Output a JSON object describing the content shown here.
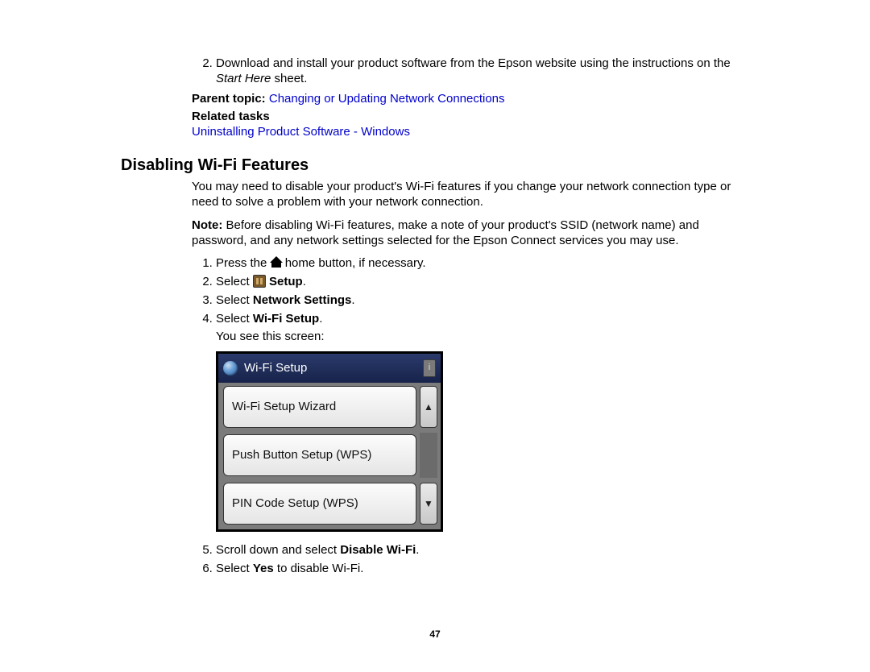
{
  "list2": {
    "item_text_before": "Download and install your product software from the Epson website using the instructions on the ",
    "item_italic": "Start Here",
    "item_text_after": " sheet."
  },
  "parent_topic_label": "Parent topic: ",
  "parent_topic_link": "Changing or Updating Network Connections",
  "related_tasks_label": "Related tasks",
  "related_task_link": "Uninstalling Product Software - Windows",
  "heading": "Disabling Wi-Fi Features",
  "intro": "You may need to disable your product's Wi-Fi features if you change your network connection type or need to solve a problem with your network connection.",
  "note_label": "Note: ",
  "note_text": "Before disabling Wi-Fi features, make a note of your product's SSID (network name) and password, and any network settings selected for the Epson Connect services you may use.",
  "steps": {
    "s1a": "Press the ",
    "s1b": " home button, if necessary.",
    "s2a": "Select ",
    "s2b": " Setup",
    "s2c": ".",
    "s3a": "Select ",
    "s3b": "Network Settings",
    "s3c": ".",
    "s4a": "Select ",
    "s4b": "Wi-Fi Setup",
    "s4c": ".",
    "s4d": "You see this screen:",
    "s5a": "Scroll down and select ",
    "s5b": "Disable Wi-Fi",
    "s5c": ".",
    "s6a": "Select ",
    "s6b": "Yes",
    "s6c": " to disable Wi-Fi."
  },
  "lcd": {
    "title": "Wi-Fi Setup",
    "items": [
      "Wi-Fi Setup Wizard",
      "Push Button Setup (WPS)",
      "PIN Code Setup (WPS)"
    ]
  },
  "page_number": "47"
}
